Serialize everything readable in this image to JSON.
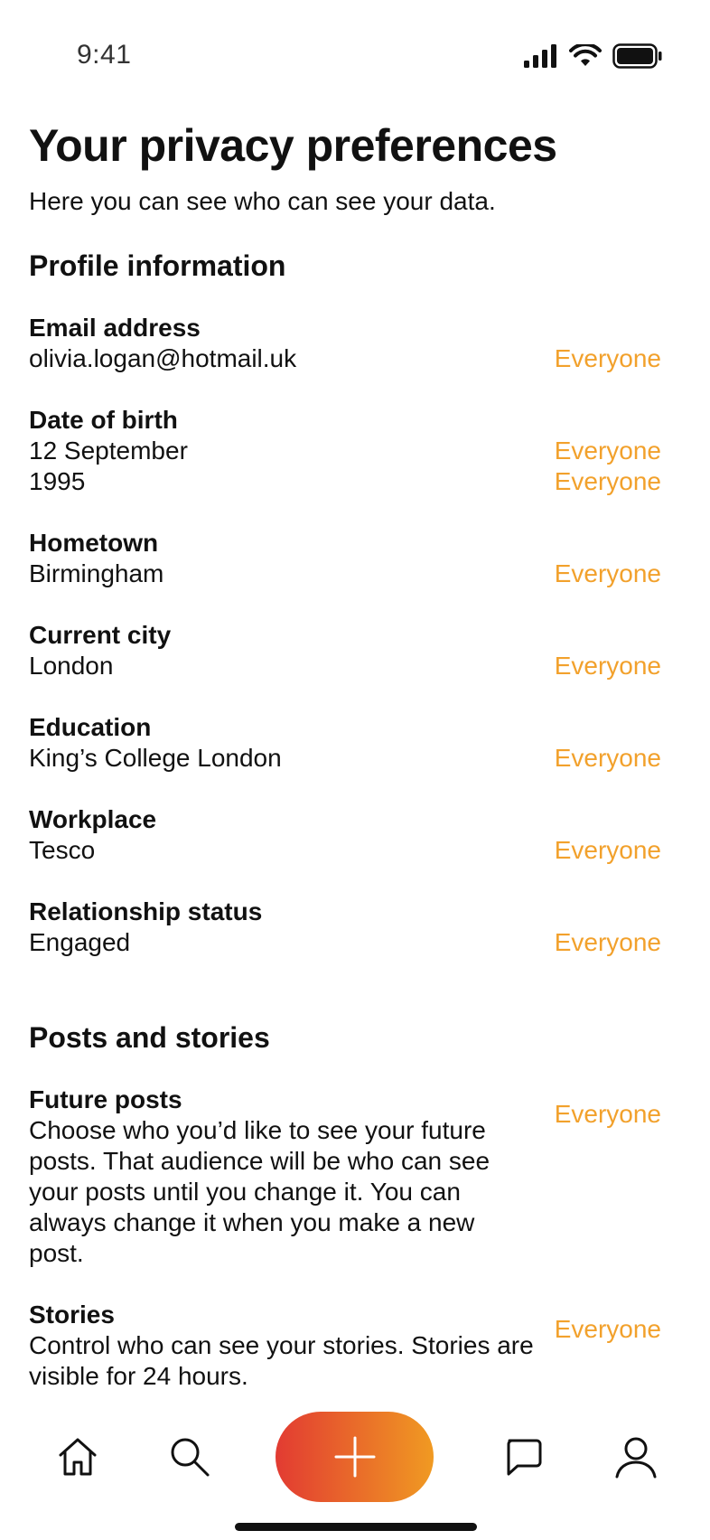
{
  "status_bar": {
    "time": "9:41"
  },
  "page": {
    "title": "Your privacy preferences",
    "subtitle": "Here you can see who can see your data."
  },
  "sections": {
    "profile": {
      "title": "Profile information",
      "items": {
        "email": {
          "label": "Email address",
          "value": "olivia.logan@hotmail.uk",
          "audience": "Everyone"
        },
        "dob": {
          "label": "Date of birth",
          "value_line1": "12 September",
          "value_line2": "1995",
          "audience_line1": "Everyone",
          "audience_line2": "Everyone"
        },
        "hometown": {
          "label": "Hometown",
          "value": "Birmingham",
          "audience": "Everyone"
        },
        "city": {
          "label": "Current city",
          "value": "London",
          "audience": "Everyone"
        },
        "education": {
          "label": "Education",
          "value": "King’s College London",
          "audience": "Everyone"
        },
        "workplace": {
          "label": "Workplace",
          "value": "Tesco",
          "audience": "Everyone"
        },
        "relationship": {
          "label": "Relationship status",
          "value": "Engaged",
          "audience": "Everyone"
        }
      }
    },
    "posts": {
      "title": "Posts and stories",
      "items": {
        "future_posts": {
          "label": "Future posts",
          "value": "Choose who you’d like to see your future posts. That audience will be who can see your posts until you change it. You can always change it when you make a new post.",
          "audience": "Everyone"
        },
        "stories": {
          "label": "Stories",
          "value": "Control who can see your stories. Stories are visible for 24 hours.",
          "audience": "Everyone"
        }
      }
    }
  },
  "bottom_nav": {
    "icons": [
      "home-icon",
      "search-icon",
      "plus-icon",
      "chat-icon",
      "profile-icon"
    ]
  },
  "colors": {
    "accent": "#F2A12C",
    "fab_gradient_start": "#E23B32",
    "fab_gradient_end": "#F09A22",
    "text": "#111111"
  }
}
